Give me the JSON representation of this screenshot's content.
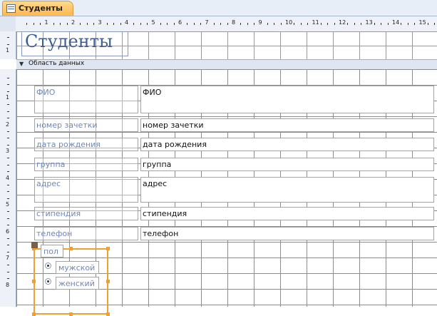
{
  "tab": {
    "label": "Студенты"
  },
  "ruler": {
    "h_labels": [
      "1",
      "2",
      "3",
      "4",
      "5",
      "6",
      "7",
      "8",
      "9",
      "10",
      "11",
      "12",
      "13",
      "14",
      "15"
    ],
    "v_header_labels": [
      "1"
    ],
    "v_detail_labels": [
      "1",
      "2",
      "3",
      "4",
      "5",
      "6",
      "7",
      "8"
    ]
  },
  "header": {
    "title": "Студенты"
  },
  "detail_bar": {
    "icon": "section-arrow-icon",
    "label": "Область данных"
  },
  "fields": [
    {
      "label": "ФИО",
      "value": "ФИО"
    },
    {
      "label": "номер зачетки",
      "value": "номер зачетки"
    },
    {
      "label": "дата рождения",
      "value": "дата рождения"
    },
    {
      "label": "группа",
      "value": "группа"
    },
    {
      "label": "адрес",
      "value": "адрес"
    },
    {
      "label": "стипендия",
      "value": "стипендия"
    },
    {
      "label": "телефон",
      "value": "телефон"
    }
  ],
  "option_group": {
    "label": "пол",
    "options": [
      {
        "text": "мужской"
      },
      {
        "text": "женский"
      }
    ]
  },
  "colors": {
    "tab": "#ffb84d",
    "selection": "#f0a030",
    "label_text": "#6f87b8",
    "title_text": "#3c5f93"
  }
}
